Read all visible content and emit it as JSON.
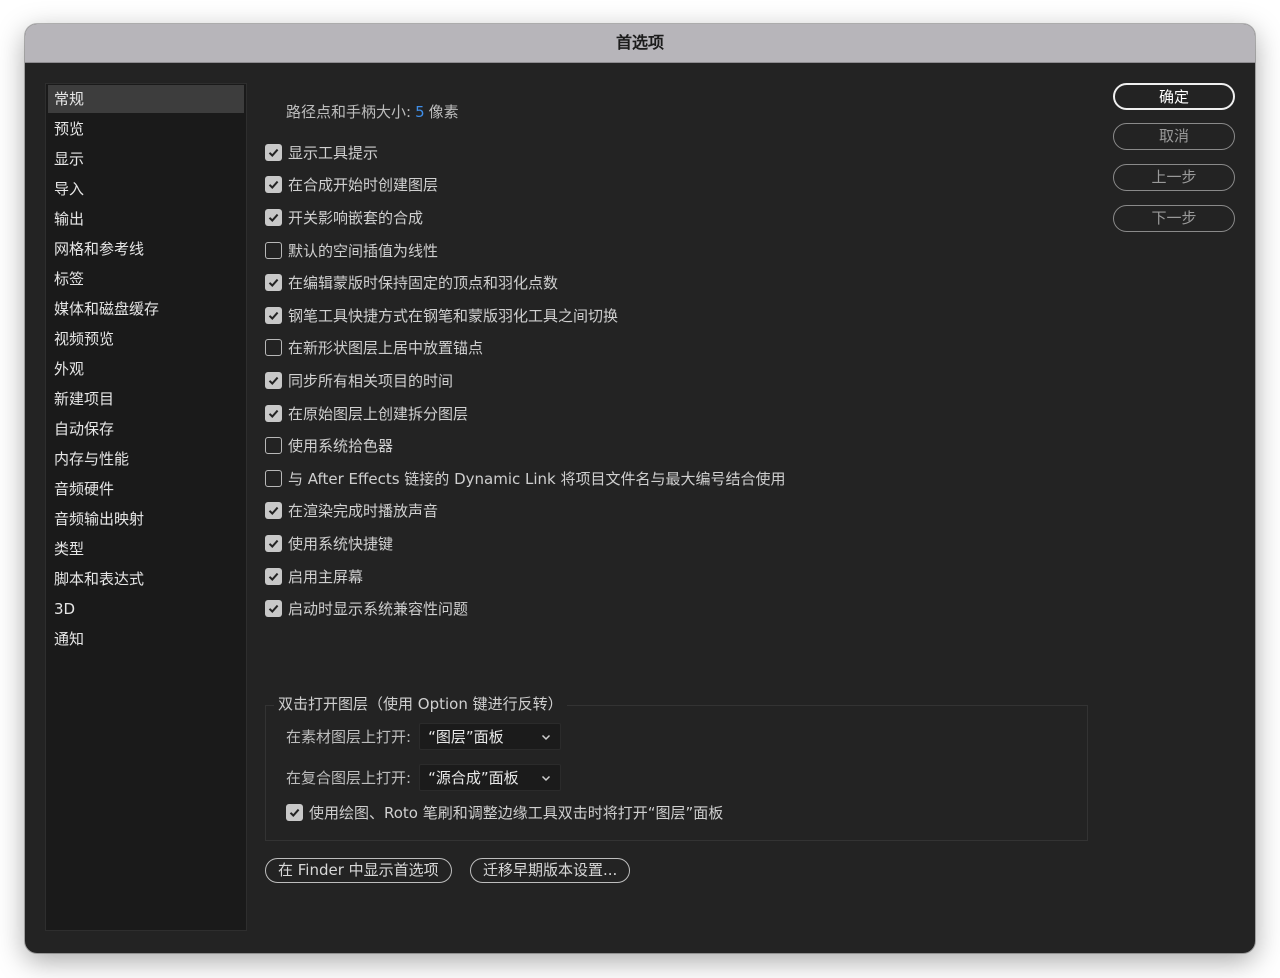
{
  "window": {
    "title": "首选项"
  },
  "sidebar": {
    "items": [
      {
        "label": "常规",
        "selected": true
      },
      {
        "label": "预览",
        "selected": false
      },
      {
        "label": "显示",
        "selected": false
      },
      {
        "label": "导入",
        "selected": false
      },
      {
        "label": "输出",
        "selected": false
      },
      {
        "label": "网格和参考线",
        "selected": false
      },
      {
        "label": "标签",
        "selected": false
      },
      {
        "label": "媒体和磁盘缓存",
        "selected": false
      },
      {
        "label": "视频预览",
        "selected": false
      },
      {
        "label": "外观",
        "selected": false
      },
      {
        "label": "新建项目",
        "selected": false
      },
      {
        "label": "自动保存",
        "selected": false
      },
      {
        "label": "内存与性能",
        "selected": false
      },
      {
        "label": "音频硬件",
        "selected": false
      },
      {
        "label": "音频输出映射",
        "selected": false
      },
      {
        "label": "类型",
        "selected": false
      },
      {
        "label": "脚本和表达式",
        "selected": false
      },
      {
        "label": "3D",
        "selected": false
      },
      {
        "label": "通知",
        "selected": false
      }
    ]
  },
  "general": {
    "path_point_size": {
      "label": "路径点和手柄大小:",
      "value": "5",
      "unit": "像素"
    },
    "checkboxes": [
      {
        "label": "显示工具提示",
        "checked": true
      },
      {
        "label": "在合成开始时创建图层",
        "checked": true
      },
      {
        "label": "开关影响嵌套的合成",
        "checked": true
      },
      {
        "label": "默认的空间插值为线性",
        "checked": false
      },
      {
        "label": "在编辑蒙版时保持固定的顶点和羽化点数",
        "checked": true
      },
      {
        "label": "钢笔工具快捷方式在钢笔和蒙版羽化工具之间切换",
        "checked": true
      },
      {
        "label": "在新形状图层上居中放置锚点",
        "checked": false
      },
      {
        "label": "同步所有相关项目的时间",
        "checked": true
      },
      {
        "label": "在原始图层上创建拆分图层",
        "checked": true
      },
      {
        "label": "使用系统拾色器",
        "checked": false
      },
      {
        "label": "与 After Effects 链接的 Dynamic Link 将项目文件名与最大编号结合使用",
        "checked": false
      },
      {
        "label": "在渲染完成时播放声音",
        "checked": true
      },
      {
        "label": "使用系统快捷键",
        "checked": true
      },
      {
        "label": "启用主屏幕",
        "checked": true
      },
      {
        "label": "启动时显示系统兼容性问题",
        "checked": true
      }
    ],
    "double_click_group": {
      "title": "双击打开图层（使用 Option 键进行反转）",
      "footage_label": "在素材图层上打开:",
      "footage_value": "“图层”面板",
      "comp_label": "在复合图层上打开:",
      "comp_value": "“源合成”面板",
      "paint_checkbox": {
        "label": "使用绘图、Roto 笔刷和调整边缘工具双击时将打开“图层”面板",
        "checked": true
      }
    },
    "reveal_button": "在 Finder 中显示首选项",
    "migrate_button": "迁移早期版本设置..."
  },
  "actions": {
    "ok": "确定",
    "cancel": "取消",
    "previous": "上一步",
    "next": "下一步"
  }
}
